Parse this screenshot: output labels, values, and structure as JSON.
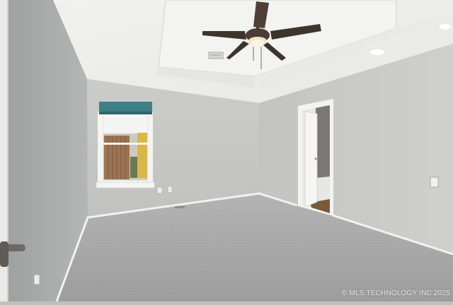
{
  "photo": {
    "subject": "empty-bedroom",
    "watermark": "© MLS TECHNOLOGY INC 2025"
  },
  "colors": {
    "wall_left": "#a9abaa",
    "wall_back": "#c6c7c5",
    "wall_right": "#c9cac8",
    "ceiling": "#eeeeec",
    "carpet": "#a6a7a6",
    "trim": "#f2f2f0",
    "fan": "#4a3d34",
    "curtain": "#3f7f86"
  }
}
